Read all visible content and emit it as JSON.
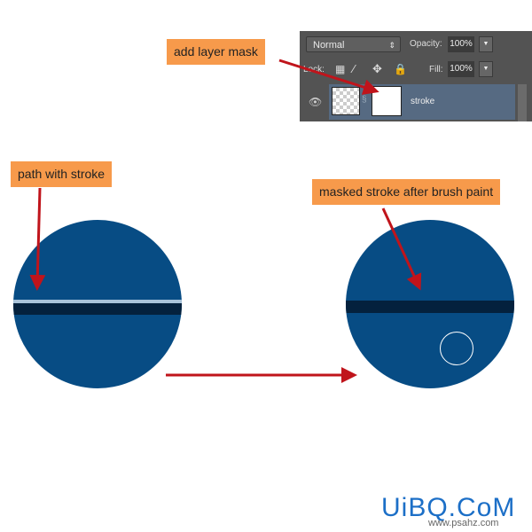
{
  "layers_panel": {
    "blend_mode": "Normal",
    "opacity_label": "Opacity:",
    "opacity_value": "100%",
    "lock_label": "Lock:",
    "fill_label": "Fill:",
    "fill_value": "100%",
    "layer_name": "stroke"
  },
  "annotations": {
    "add_mask": "add layer mask",
    "path_stroke": "path with stroke",
    "masked": "masked stroke after brush paint"
  },
  "colors": {
    "note_bg": "#f79a4b",
    "circle": "#074c84",
    "arrow": "#c0141b"
  },
  "watermark": {
    "logo": "UiBQ.CoM",
    "url": "www.psahz.com"
  }
}
